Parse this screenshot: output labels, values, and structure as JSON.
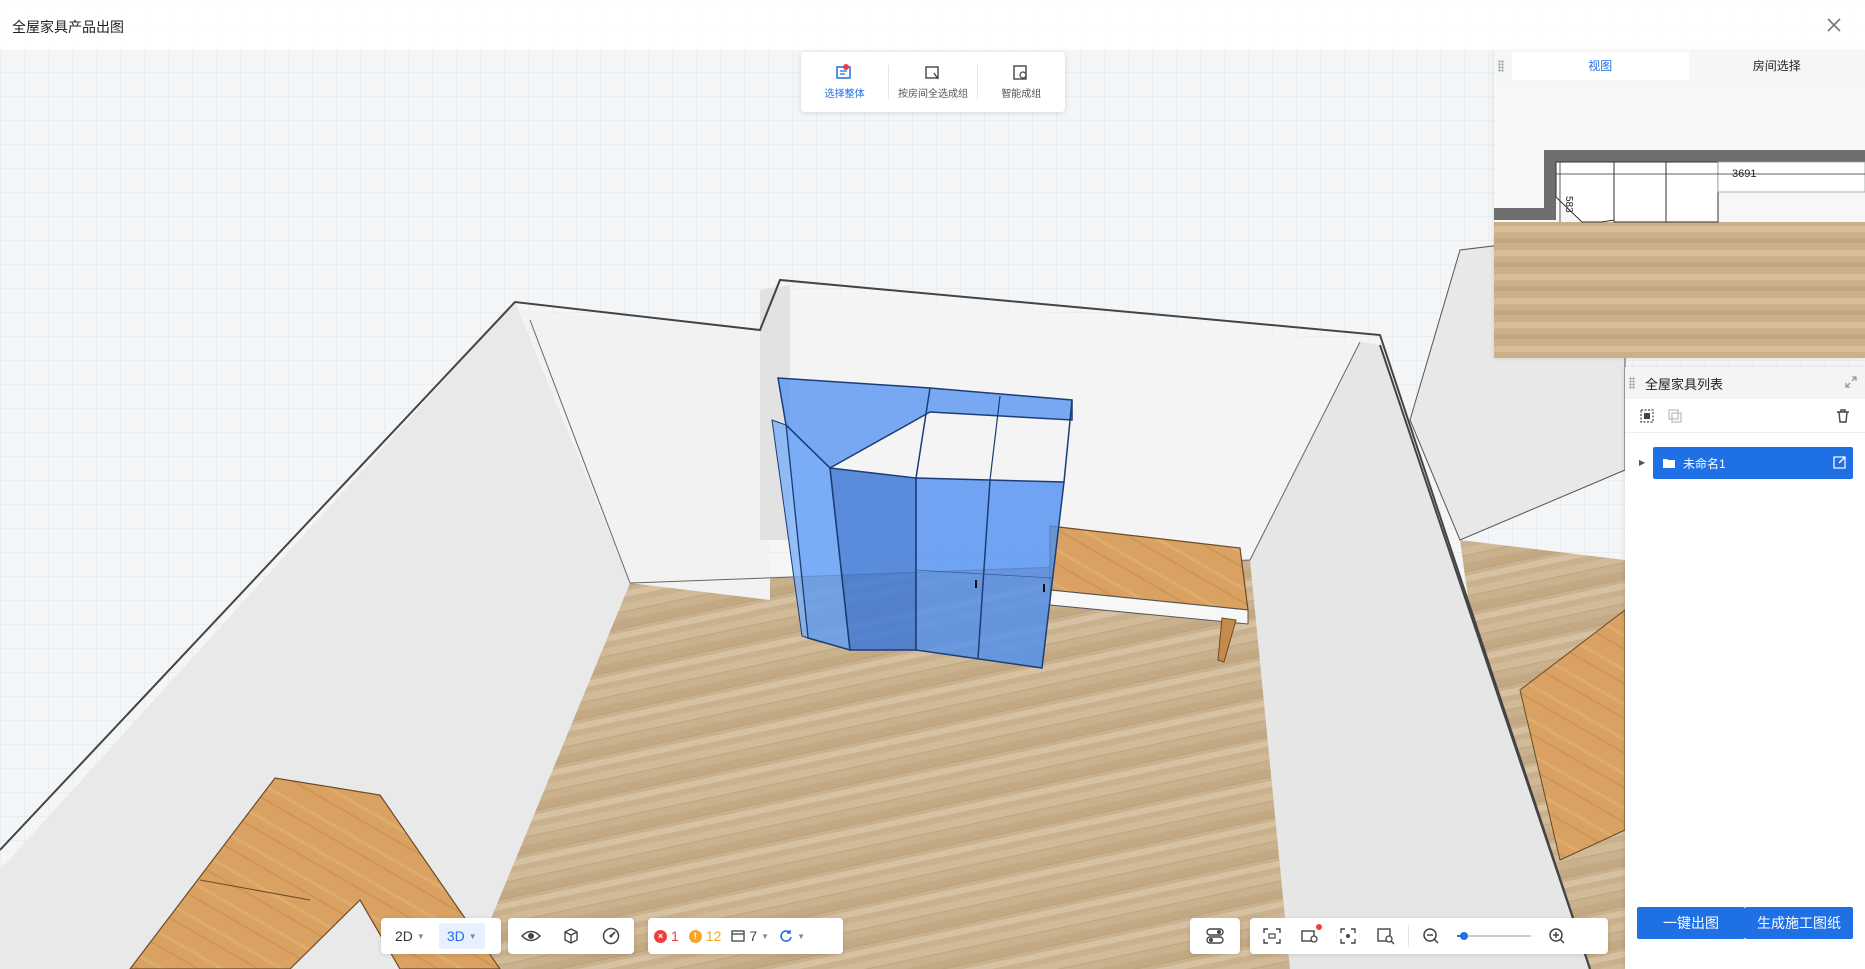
{
  "window": {
    "title": "全屋家具产品出图"
  },
  "top_toolbar": {
    "tools": [
      {
        "label": "选择整体",
        "active": true
      },
      {
        "label": "按房间全选成组",
        "active": false
      },
      {
        "label": "智能成组",
        "active": false
      }
    ]
  },
  "view_panel": {
    "tabs": [
      {
        "label": "视图",
        "active": true
      },
      {
        "label": "房间选择",
        "active": false
      }
    ],
    "dimensions": {
      "width": "3691",
      "depth": "583"
    }
  },
  "furniture_list": {
    "title": "全屋家具列表",
    "items": [
      {
        "label": "未命名1",
        "selected": true
      }
    ],
    "actions": {
      "one_click": "一键出图",
      "construction": "生成施工图纸"
    }
  },
  "bottom_toolbar": {
    "view_modes": [
      {
        "label": "2D",
        "active": false
      },
      {
        "label": "3D",
        "active": true
      }
    ],
    "status": {
      "errors": "1",
      "warnings": "12",
      "components": "7"
    },
    "zoom_level": 0.1
  },
  "colors": {
    "accent": "#1f6fe5",
    "error": "#f03e3e",
    "warning": "#f5a623"
  }
}
